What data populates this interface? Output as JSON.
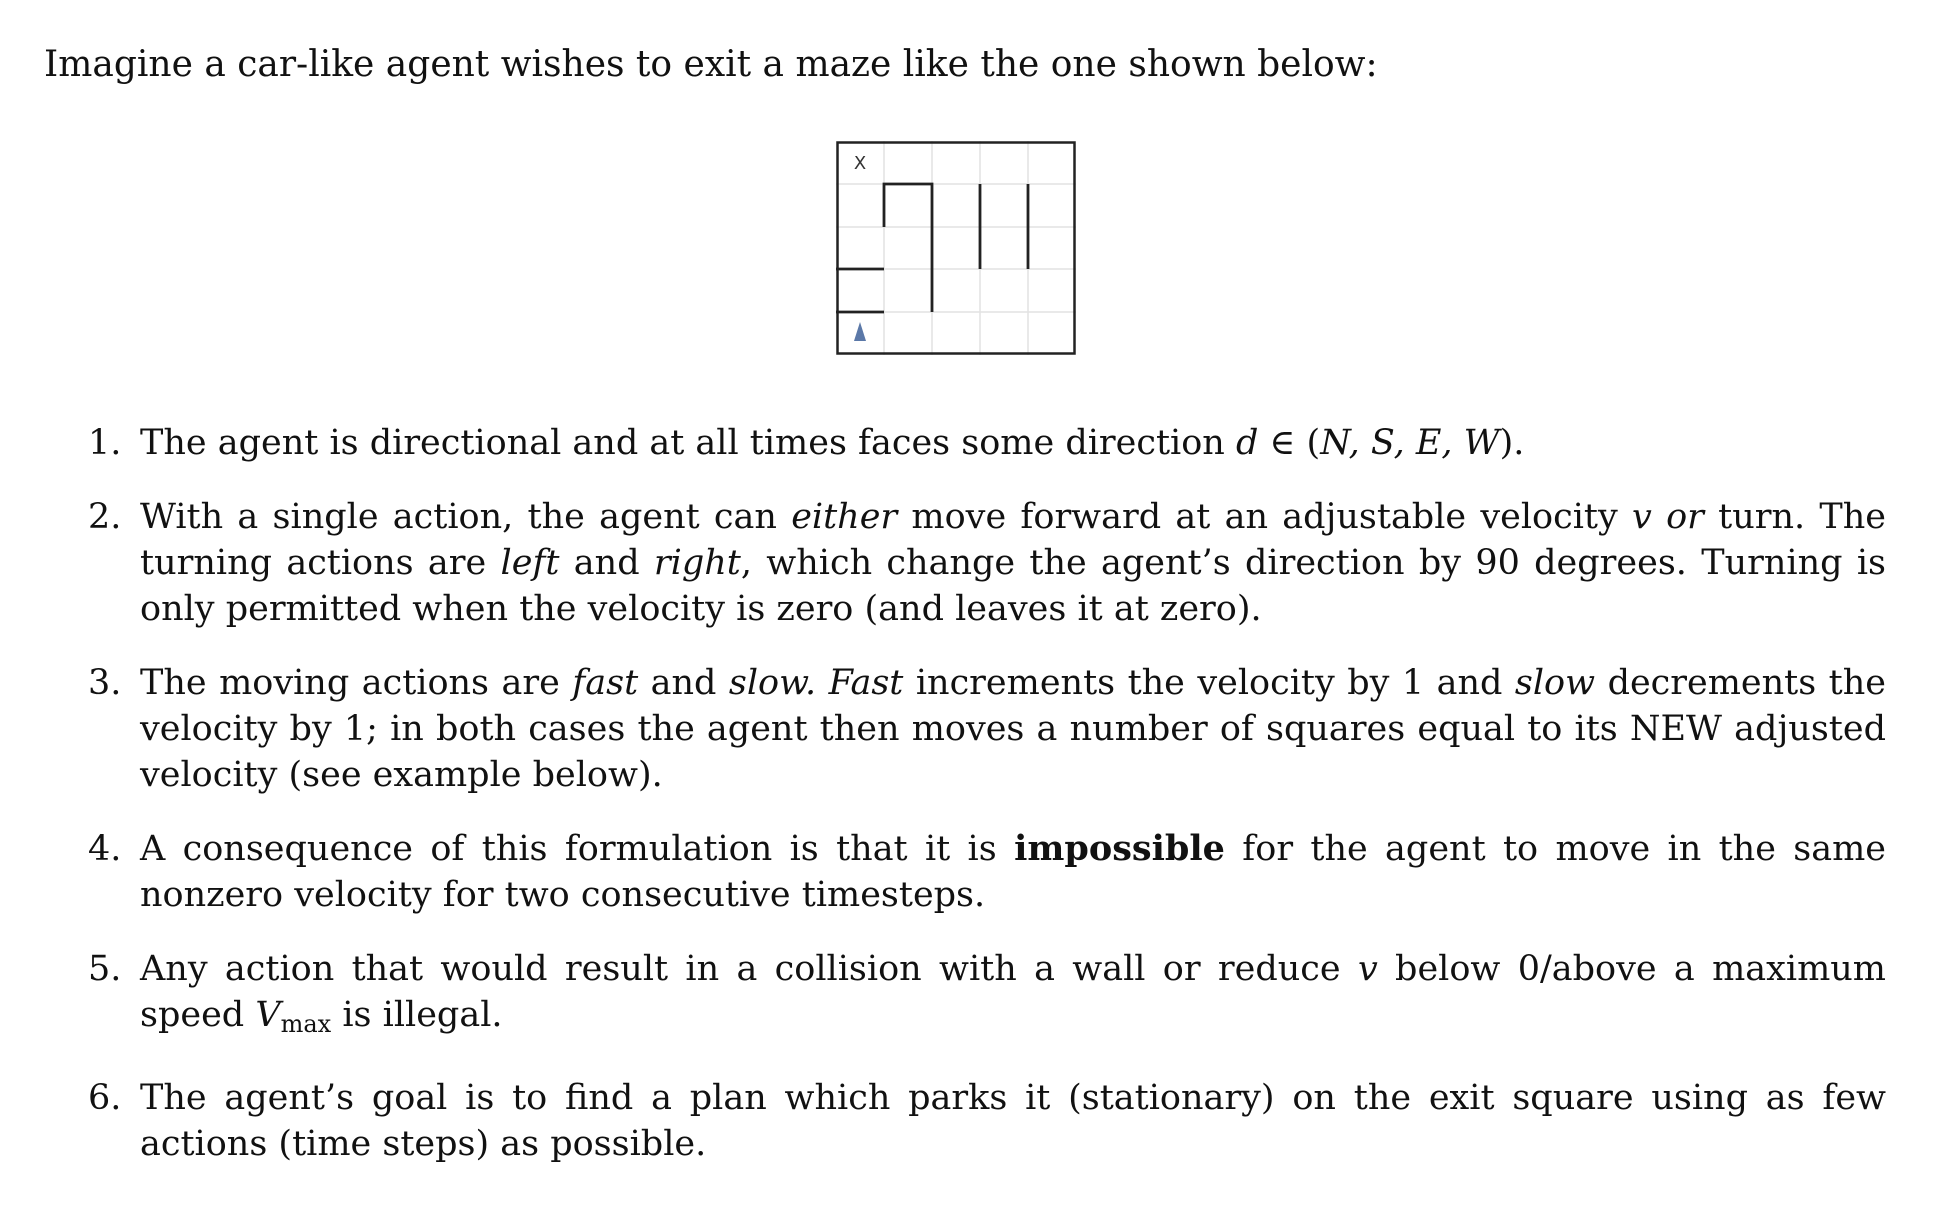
{
  "intro": "Imagine a car-like agent wishes to exit a maze like the one shown below:",
  "maze": {
    "exit_label": "X",
    "agent_icon": "triangle-up",
    "agent_color": "#5b78a8"
  },
  "items": [
    {
      "number": "1.",
      "parts": [
        {
          "t": "The agent is directional and at all times faces some direction "
        },
        {
          "t": "d",
          "s": "m"
        },
        {
          "t": " ∈ ("
        },
        {
          "t": "N, S, E, W",
          "s": "m"
        },
        {
          "t": ")."
        }
      ]
    },
    {
      "number": "2.",
      "parts": [
        {
          "t": "With a single action, the agent can "
        },
        {
          "t": "either",
          "s": "em"
        },
        {
          "t": " move forward at an adjustable velocity "
        },
        {
          "t": "v",
          "s": "m"
        },
        {
          "t": " "
        },
        {
          "t": "or",
          "s": "em"
        },
        {
          "t": " turn. The turning actions are "
        },
        {
          "t": "left",
          "s": "em"
        },
        {
          "t": " and "
        },
        {
          "t": "right",
          "s": "em"
        },
        {
          "t": ", which change the agent’s direction by 90 degrees. Turning is only permitted when the velocity is zero (and leaves it at zero)."
        }
      ]
    },
    {
      "number": "3.",
      "parts": [
        {
          "t": "The moving actions are "
        },
        {
          "t": "fast",
          "s": "em"
        },
        {
          "t": " and "
        },
        {
          "t": "slow.",
          "s": "em"
        },
        {
          "t": " "
        },
        {
          "t": "Fast",
          "s": "em"
        },
        {
          "t": " increments the velocity by 1 and "
        },
        {
          "t": "slow",
          "s": "em"
        },
        {
          "t": " decrements the velocity by 1; in both cases the agent then moves a number of squares equal to its NEW adjusted velocity (see example below)."
        }
      ]
    },
    {
      "number": "4.",
      "parts": [
        {
          "t": "A consequence of this formulation is that it is "
        },
        {
          "t": "impossible",
          "s": "b"
        },
        {
          "t": " for the agent to move in the same nonzero velocity for two consecutive timesteps."
        }
      ]
    },
    {
      "number": "5.",
      "parts": [
        {
          "t": "Any action that would result in a collision with a wall or reduce "
        },
        {
          "t": "v",
          "s": "m"
        },
        {
          "t": " below 0/above a maximum speed "
        },
        {
          "t": "V",
          "s": "m"
        },
        {
          "t": "max",
          "s": "sub"
        },
        {
          "t": " is illegal."
        }
      ]
    },
    {
      "number": "6.",
      "parts": [
        {
          "t": "The agent’s goal is to find a plan which parks it (stationary) on the exit square using as few actions (time steps) as possible."
        }
      ]
    }
  ]
}
